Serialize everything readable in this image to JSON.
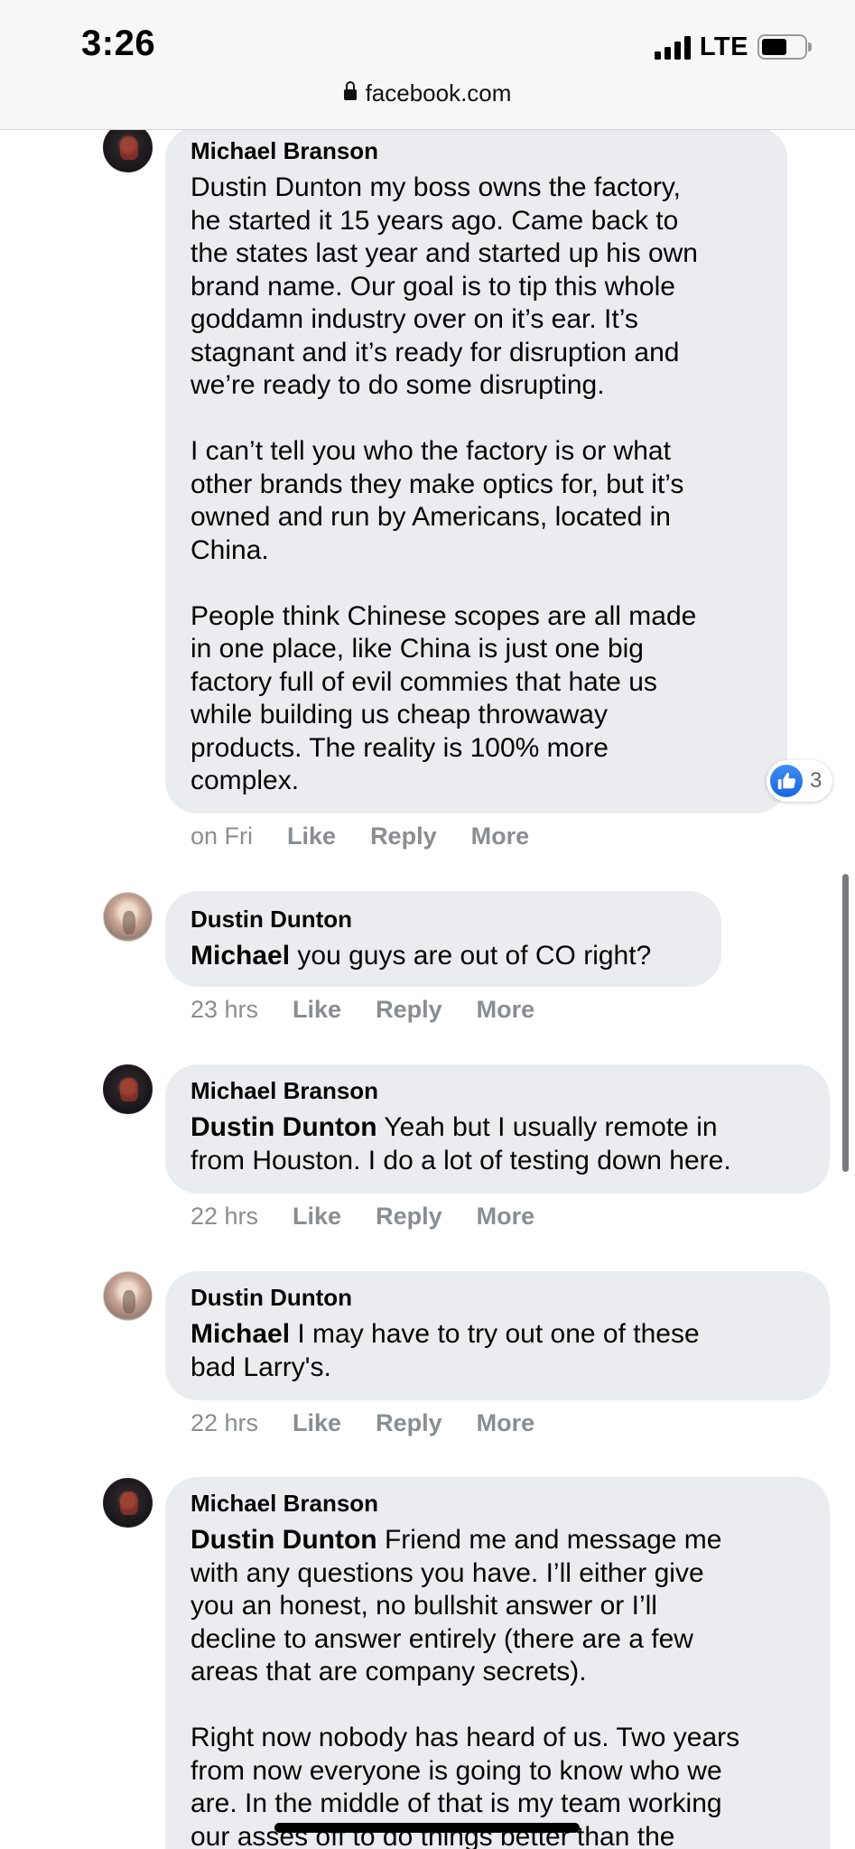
{
  "status_bar": {
    "time": "3:26",
    "network": "LTE",
    "battery_level": 0.6
  },
  "browser": {
    "url": "facebook.com"
  },
  "comments": [
    {
      "author": "Michael Branson",
      "mention": "",
      "text": "Dustin Dunton my boss owns the factory,\nhe started it 15 years ago. Came back to\nthe states last year and started up his own\nbrand name. Our goal is to tip this whole\ngoddamn industry over on it’s ear. It’s\nstagnant and it’s ready for disruption and\nwe’re ready to do some disrupting.\n\nI can’t tell you who the factory is or what\nother brands they make optics for, but it’s\nowned and run by Americans, located in\nChina.\n\nPeople think Chinese scopes are all made\nin one place, like China is just one big\nfactory full of evil commies that hate us\nwhile building us cheap throwaway\nproducts. The reality is 100% more\ncomplex.",
      "time": "on Fri",
      "reaction_count": "3"
    },
    {
      "author": "Dustin Dunton",
      "mention": "Michael",
      "text": " you guys are out of CO right?",
      "time": "23 hrs"
    },
    {
      "author": "Michael Branson",
      "mention": "Dustin Dunton",
      "text": " Yeah but I usually remote in\nfrom Houston. I do a lot of testing down here.",
      "time": "22 hrs"
    },
    {
      "author": "Dustin Dunton",
      "mention": "Michael",
      "text": " I may have to try out one of these\nbad Larry's.",
      "time": "22 hrs"
    },
    {
      "author": "Michael Branson",
      "mention": "Dustin Dunton",
      "text": " Friend me and message me\nwith any questions you have. I’ll either give\nyou an honest, no bullshit answer or I’ll\ndecline to answer entirely (there are a few\nareas that are company secrets).\n\nRight now nobody has heard of us. Two years\nfrom now everyone is going to know who we\nare. In the middle of that is my team working\nour asses off to do things better than the",
      "time": ""
    }
  ],
  "actions": {
    "like": "Like",
    "reply": "Reply",
    "more": "More"
  }
}
